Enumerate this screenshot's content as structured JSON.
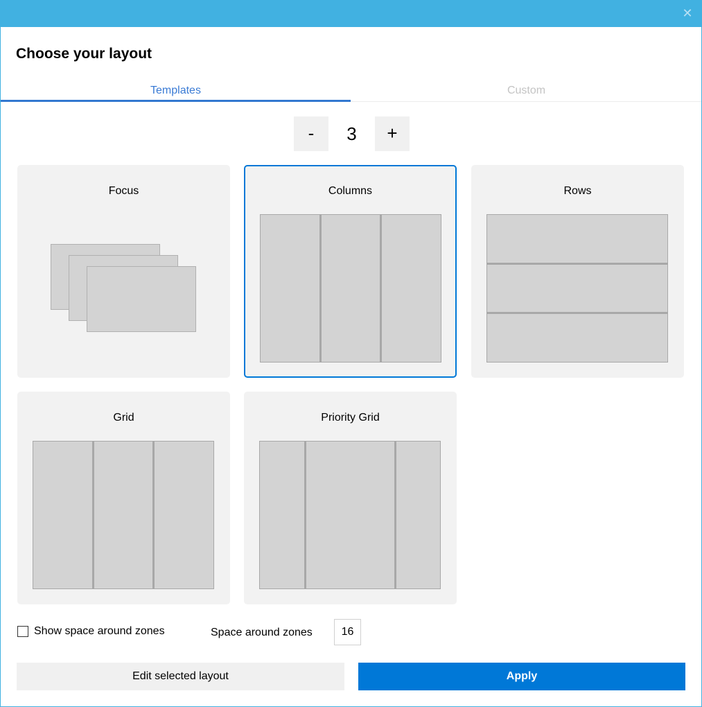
{
  "window": {
    "titlebar_color": "#41b1e1",
    "close_icon": "close-icon"
  },
  "heading": "Choose your layout",
  "tabs": [
    {
      "label": "Templates",
      "active": true
    },
    {
      "label": "Custom",
      "active": false
    }
  ],
  "stepper": {
    "minus_label": "-",
    "value": "3",
    "plus_label": "+"
  },
  "templates": [
    {
      "name": "Focus",
      "type": "focus",
      "selected": false
    },
    {
      "name": "Columns",
      "type": "columns",
      "selected": true
    },
    {
      "name": "Rows",
      "type": "rows",
      "selected": false
    },
    {
      "name": "Grid",
      "type": "grid",
      "selected": false
    },
    {
      "name": "Priority Grid",
      "type": "priority-grid",
      "selected": false
    }
  ],
  "options": {
    "show_space_label": "Show space around zones",
    "show_space_checked": false,
    "space_label": "Space around zones",
    "space_value": "16"
  },
  "buttons": {
    "edit": "Edit selected layout",
    "apply": "Apply"
  },
  "colors": {
    "accent": "#0078d7",
    "tab_active": "#3a7bd5",
    "card_bg": "#f2f2f2",
    "zone_fill": "#d3d3d3"
  }
}
